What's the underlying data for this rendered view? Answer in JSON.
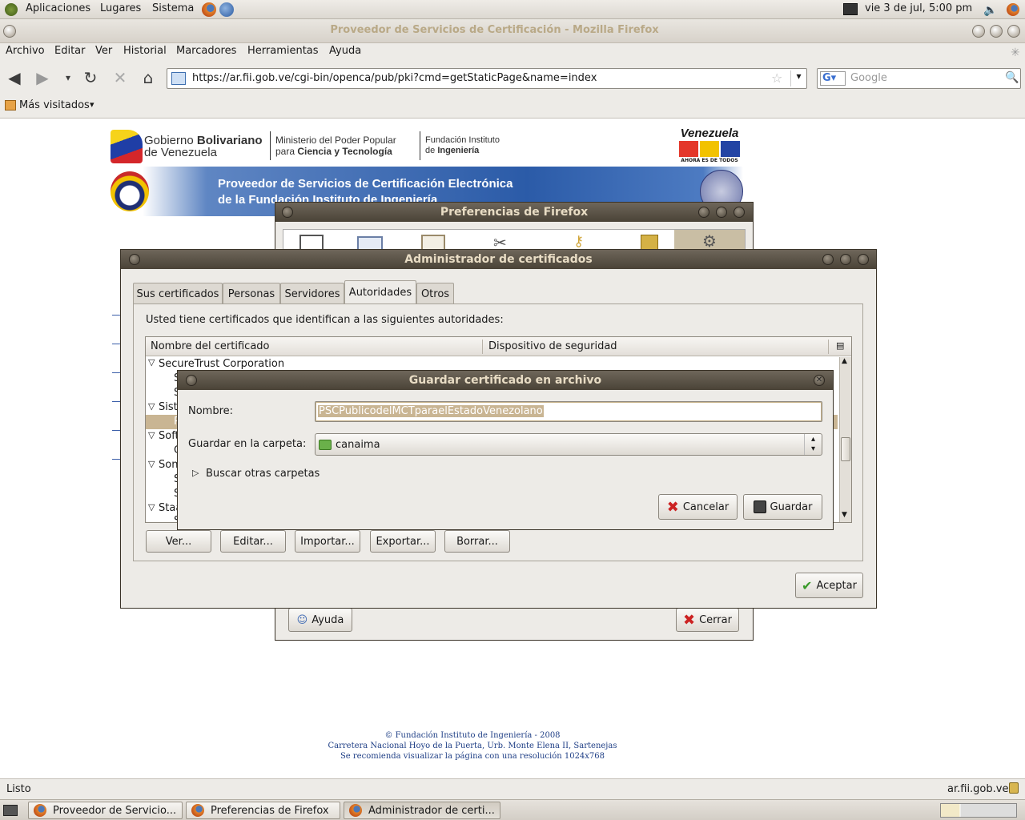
{
  "top_panel": {
    "menus": [
      "Aplicaciones",
      "Lugares",
      "Sistema"
    ],
    "clock": "vie  3 de jul,  5:00 pm"
  },
  "browser": {
    "window_title": "Proveedor de Servicios de Certificación - Mozilla Firefox",
    "menu": [
      "Archivo",
      "Editar",
      "Ver",
      "Historial",
      "Marcadores",
      "Herramientas",
      "Ayuda"
    ],
    "url": "https://ar.fii.gob.ve/cgi-bin/openca/pub/pki?cmd=getStaticPage&name=index",
    "search_placeholder": "Google",
    "bookmark": "Más visitados",
    "status_left": "Listo",
    "status_right": "ar.fii.gob.ve"
  },
  "page": {
    "gov_line1_a": "Gobierno",
    "gov_line1_b": "Bolivariano",
    "gov_line2": "de Venezuela",
    "ministry_line1": "Ministerio del Poder Popular",
    "ministry_line2_a": "para",
    "ministry_line2_b": "Ciencia y Tecnología",
    "fii_line1": "Fundación Instituto",
    "fii_line2_a": "de",
    "fii_line2_b": "Ingeniería",
    "venezuela": "Venezuela",
    "venezuela_sub": "AHORA ES DE TODOS",
    "banner_line1": "Proveedor de Servicios de Certificación Electrónica",
    "banner_line2": "de la Fundación Instituto de Ingeniería",
    "footer_line1": "© Fundación Instituto de Ingeniería - 2008",
    "footer_line2": "Carretera Nacional Hoyo de la Puerta, Urb. Monte Elena II, Sartenejas",
    "footer_line3": "Se recomienda visualizar la página con una resolución 1024x768"
  },
  "prefs_dialog": {
    "title": "Preferencias de Firefox",
    "help": "Ayuda",
    "close": "Cerrar"
  },
  "cert_manager": {
    "title": "Administrador de certificados",
    "tabs": [
      "Sus certificados",
      "Personas",
      "Servidores",
      "Autoridades",
      "Otros"
    ],
    "active_tab": "Autoridades",
    "description": "Usted tiene certificados que identifican a las siguientes autoridades:",
    "col_name": "Nombre del certificado",
    "col_device": "Dispositivo de seguridad",
    "tree_first": "SecureTrust Corporation",
    "tree_partial": [
      "S",
      "S",
      "Sist",
      "P",
      "Soft",
      "C",
      "Son",
      "S",
      "S",
      "Staa",
      "S"
    ],
    "buttons": [
      "Ver...",
      "Editar...",
      "Importar...",
      "Exportar...",
      "Borrar..."
    ],
    "ok": "Aceptar"
  },
  "save_dialog": {
    "title": "Guardar certificado en archivo",
    "name_label": "Nombre:",
    "name_value": "PSCPublicodelMCTparaelEstadoVenezolano",
    "folder_label": "Guardar en la carpeta:",
    "folder_value": "canaima",
    "browse": "Buscar otras carpetas",
    "cancel": "Cancelar",
    "save": "Guardar"
  },
  "taskbar": {
    "items": [
      "Proveedor de Servicio...",
      "Preferencias de Firefox",
      "Administrador de certi..."
    ]
  }
}
